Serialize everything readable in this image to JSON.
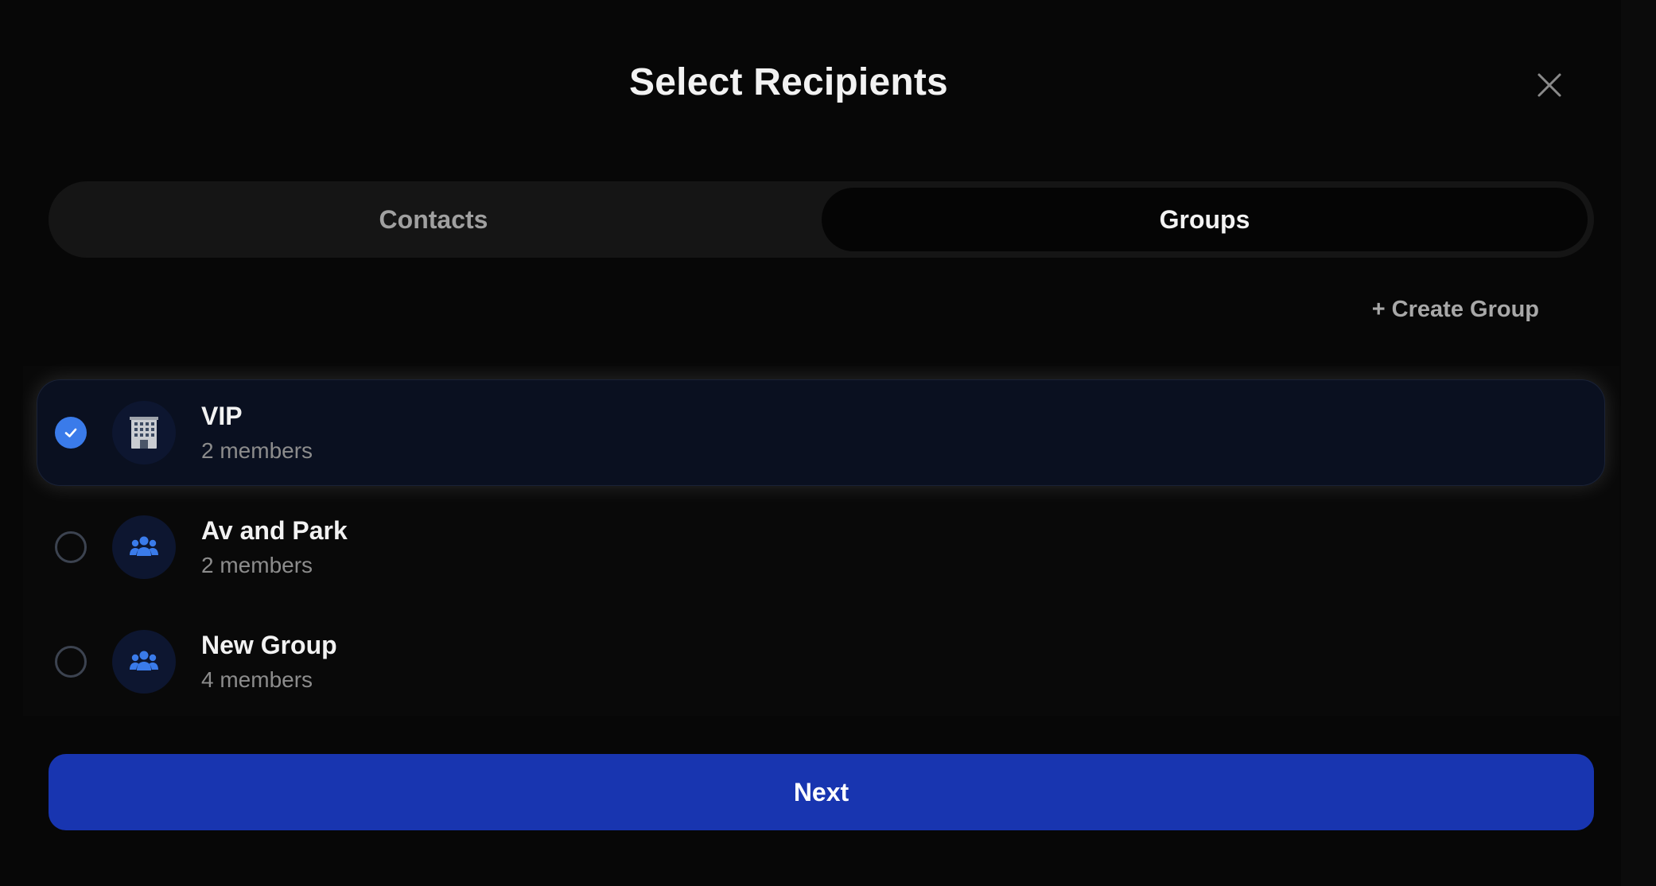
{
  "dialog": {
    "title": "Select Recipients",
    "close_icon": "close-icon"
  },
  "tabs": {
    "items": [
      {
        "label": "Contacts",
        "active": false
      },
      {
        "label": "Groups",
        "active": true
      }
    ]
  },
  "actions": {
    "create_group_label": "+ Create Group",
    "next_label": "Next"
  },
  "groups": [
    {
      "name": "VIP",
      "members": "2 members",
      "selected": true,
      "icon": "office-building-icon"
    },
    {
      "name": "Av and Park",
      "members": "2 members",
      "selected": false,
      "icon": "people-group-icon"
    },
    {
      "name": "New Group",
      "members": "4 members",
      "selected": false,
      "icon": "people-group-icon"
    }
  ],
  "colors": {
    "accent": "#3a7bea",
    "primary_button": "#1835b0",
    "selected_row": "#0a1020",
    "background": "#070707"
  }
}
